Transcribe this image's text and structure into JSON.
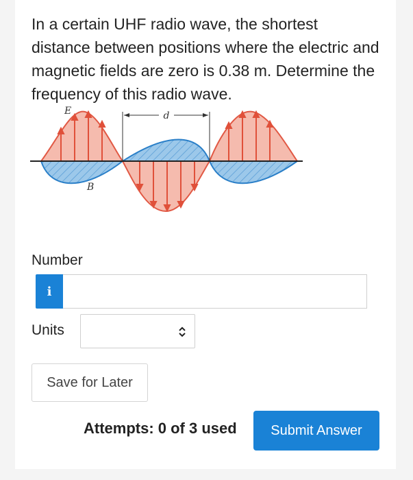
{
  "question": {
    "text": "In a certain UHF radio wave, the shortest distance between positions where the electric and magnetic fields are zero is 0.38 m. Determine the frequency of this radio wave."
  },
  "figure": {
    "e_label": "E",
    "b_label": "B",
    "d_label": "d",
    "colors": {
      "e_field": "#f5b8aa",
      "e_stroke": "#e0503a",
      "b_field": "#9cc8ea",
      "b_stroke": "#2a7fc8"
    }
  },
  "form": {
    "number_label": "Number",
    "info_icon": "i",
    "number_value": "",
    "units_label": "Units",
    "units_value": "",
    "save_label": "Save for Later",
    "attempts_text": "Attempts: 0 of 3 used",
    "submit_label": "Submit Answer"
  },
  "accent": "#1a82d6"
}
